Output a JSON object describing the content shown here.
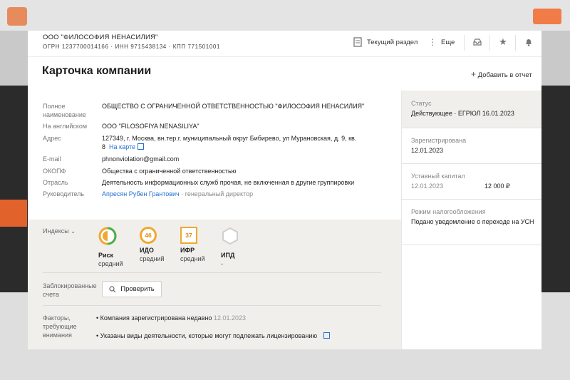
{
  "colors": {
    "accent": "#1f6fd0",
    "warning": "#f0a830",
    "risk_green": "#4caf50"
  },
  "header": {
    "company_name": "ООО \"ФИЛОСОФИЯ НЕНАСИЛИЯ\"",
    "company_ids": "ОГРН 1237700014166 · ИНН 9715438134 · КПП 771501001",
    "current_section": "Текущий раздел",
    "more": "Еще",
    "icons": [
      "inbox-icon",
      "star-icon",
      "bell-icon"
    ]
  },
  "page": {
    "title": "Карточка компании",
    "add_to_report": "Добавить в отчет"
  },
  "details": [
    {
      "label": "Полное наименование",
      "value": "ОБЩЕСТВО С ОГРАНИЧЕННОЙ ОТВЕТСТВЕННОСТЬЮ \"ФИЛОСОФИЯ НЕНАСИЛИЯ\""
    },
    {
      "label": "На английском",
      "value": "ООО \"FILOSOFIYA NENASILIYA\""
    },
    {
      "label": "Адрес",
      "value": "127349, г. Москва, вн.тер.г. муниципальный округ Бибирево, ул Мурановская, д. 9, кв. 8",
      "link": "На карте"
    },
    {
      "label": "E-mail",
      "value": "phnonviolation@gmail.com"
    },
    {
      "label": "ОКОПФ",
      "value": "Общества с ограниченной ответственностью"
    },
    {
      "label": "Отрасль",
      "value": "Деятельность информационных служб прочая, не включенная в другие группировки"
    },
    {
      "label": "Руководитель",
      "value": "Апресян Рубен Грантович",
      "suffix": " · генеральный директор"
    }
  ],
  "side": {
    "status_label": "Статус",
    "status_value": "Действующее · ЕГРЮЛ 16.01.2023",
    "registered_label": "Зарегистрирована",
    "registered_value": "12.01.2023",
    "capital_label": "Уставный капитал",
    "capital_date": "12.01.2023",
    "capital_value": "12 000 ₽",
    "tax_label": "Режим налогообложения",
    "tax_value": "Подано уведомление о переходе на УСН"
  },
  "indexes": {
    "label": "Индексы",
    "items": [
      {
        "name": "Риск",
        "level": "средний",
        "value": ""
      },
      {
        "name": "ИДО",
        "level": "средний",
        "value": "46"
      },
      {
        "name": "ИФР",
        "level": "средний",
        "value": "37"
      },
      {
        "name": "ИПД",
        "level": "-",
        "value": ""
      }
    ]
  },
  "blocked": {
    "label": "Заблокированные счета",
    "button": "Проверить"
  },
  "factors": {
    "label": "Факторы, требующие внимания",
    "items": [
      {
        "text": "Компания зарегистрирована недавно",
        "date": "12.01.2023"
      },
      {
        "text": "Указаны виды деятельности, которые могут подлежать лицензированию",
        "date": ""
      }
    ]
  }
}
